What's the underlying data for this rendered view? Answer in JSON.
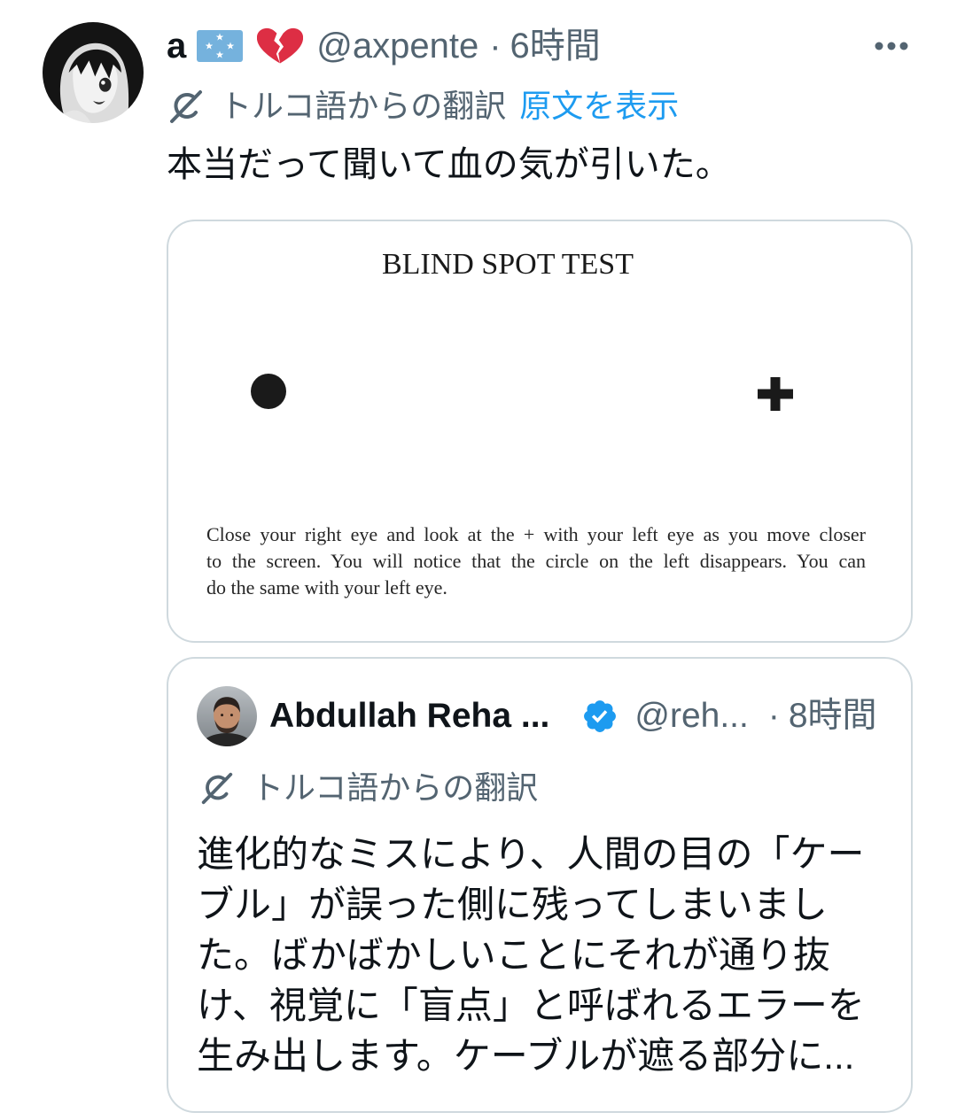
{
  "tweet": {
    "avatar_icon": "anime-girl-avatar",
    "author": {
      "display_name": "a",
      "name_emoji_icons": [
        "flag-micronesia-icon",
        "broken-heart-icon"
      ],
      "handle": "@axpente",
      "separator": "·",
      "time": "6時間"
    },
    "more_icon": "more-icon",
    "translation": {
      "icon": "translate-icon",
      "label": "トルコ語からの翻訳",
      "show_original": "原文を表示"
    },
    "text": "本当だって聞いて血の気が引いた。",
    "media": {
      "title": "BLIND SPOT TEST",
      "dot_icon": "filled-circle",
      "plus_icon": "plus-sign",
      "caption_lines": [
        "Close your right eye and look at the + with your left eye as you move closer",
        "to the screen. You will notice that the circle on the left disappears. You can",
        "do the same with your left eye."
      ]
    },
    "quote": {
      "avatar_icon": "man-avatar",
      "author": {
        "display_name": "Abdullah Reha ...",
        "verified_icon": "verified-badge-icon",
        "handle": "@reh...",
        "separator": "·",
        "time": "8時間"
      },
      "translation": {
        "icon": "translate-icon",
        "label": "トルコ語からの翻訳"
      },
      "text_lines": [
        "進化的なミスにより、人間の目の「ケー",
        "ブル」が誤った側に残ってしまいまし",
        "た。ばかばかしいことにそれが通り抜",
        "け、視覚に「盲点」と呼ばれるエラーを",
        "生み出します。ケーブルが遮る部分に..."
      ]
    }
  },
  "colors": {
    "text_primary": "#0f1419",
    "text_secondary": "#536471",
    "link": "#1d9bf0",
    "verified": "#1d9bf0",
    "card_border": "#cfd9de",
    "heart": "#dd2e44",
    "flag_blue": "#75b2dd",
    "image_ink": "#1a1a1a"
  }
}
